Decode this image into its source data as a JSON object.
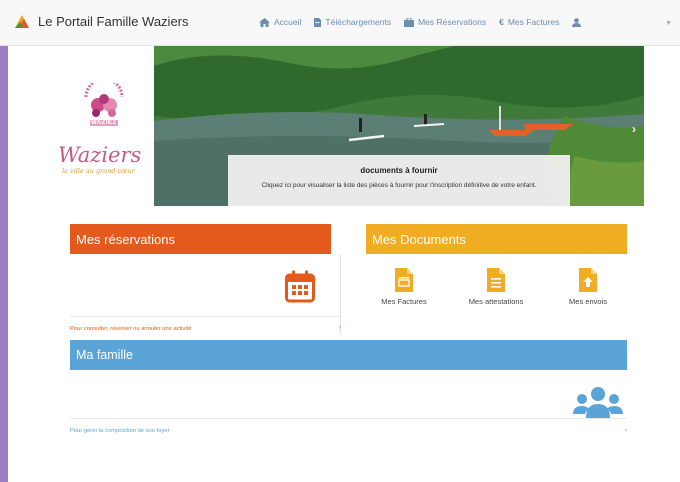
{
  "brand": {
    "title": "Le Portail Famille Waziers"
  },
  "nav": {
    "items": [
      {
        "label": "Accueil",
        "icon": "home-icon"
      },
      {
        "label": "Téléchargements",
        "icon": "file-icon"
      },
      {
        "label": "Mes Réservations",
        "icon": "briefcase-icon"
      },
      {
        "label": "Mes Factures",
        "icon": "euro-icon"
      }
    ],
    "user_icon": "user-icon"
  },
  "slider": {
    "title": "documents à fournir",
    "text": "Cliquez ici pour visualiser la liste des pièces à fournir pour l'inscription définitive de votre enfant."
  },
  "logo": {
    "town": "Waziers",
    "tagline": "la ville au grand cœur",
    "badge": "WAZIEZ"
  },
  "reservations": {
    "title": "Mes réservations",
    "link": "Pour consulter, réserver ou annuler une activité"
  },
  "documents": {
    "title": "Mes Documents",
    "items": [
      "Mes Factures",
      "Mes attestations",
      "Mes envois"
    ]
  },
  "famille": {
    "title": "Ma famille",
    "link": "Pour gérer la composition de son foyer"
  },
  "colors": {
    "orange": "#e45a1d",
    "yellow": "#f0ad24",
    "blue": "#5ba4d8",
    "purple_bg": "#9b7fc0"
  }
}
